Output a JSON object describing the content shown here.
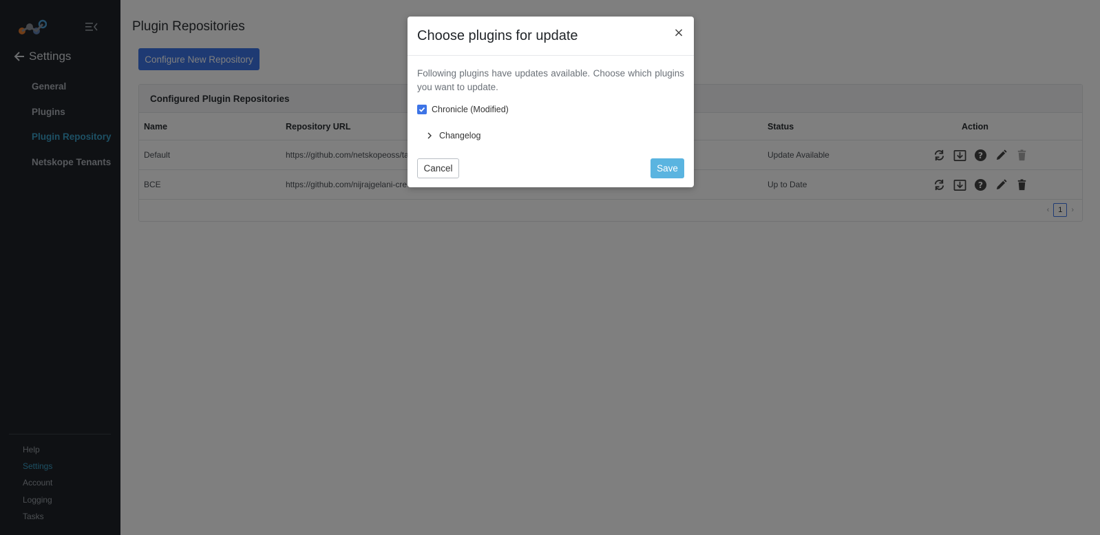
{
  "sidebar": {
    "logo_icon": "netskope-logo-icon",
    "collapse_icon": "menu-collapse-icon",
    "back_icon": "arrow-left-icon",
    "heading": "Settings",
    "items": [
      {
        "label": "General",
        "active": false
      },
      {
        "label": "Plugins",
        "active": false
      },
      {
        "label": "Plugin Repository",
        "active": true
      },
      {
        "label": "Netskope Tenants",
        "active": false
      }
    ],
    "footer": [
      {
        "label": "Help",
        "active": false
      },
      {
        "label": "Settings",
        "active": true
      },
      {
        "label": "Account",
        "active": false
      },
      {
        "label": "Logging",
        "active": false
      },
      {
        "label": "Tasks",
        "active": false
      }
    ]
  },
  "main": {
    "title": "Plugin Repositories",
    "configure_button": "Configure New Repository",
    "card_title": "Configured Plugin Repositories",
    "columns": {
      "name": "Name",
      "url": "Repository URL",
      "status": "Status",
      "action": "Action"
    },
    "rows": [
      {
        "name": "Default",
        "url": "https://github.com/netskopeoss/ta",
        "status": "Update Available"
      },
      {
        "name": "BCE",
        "url": "https://github.com/nijrajgelani-cre",
        "status": "Up to Date"
      }
    ],
    "action_icons": [
      "sync-icon",
      "download-icon",
      "help-icon",
      "edit-icon",
      "delete-icon"
    ],
    "pagination": {
      "current_page": "1"
    }
  },
  "modal": {
    "title": "Choose plugins for update",
    "close_label": "×",
    "description": "Following plugins have updates available. Choose which plugins you want to update.",
    "plugin": {
      "label": "Chronicle (Modified)",
      "checked": true
    },
    "changelog_label": "Changelog",
    "cancel_label": "Cancel",
    "save_label": "Save"
  },
  "colors": {
    "sidebar_bg": "#1e2329",
    "accent": "#3d74e6",
    "active_nav": "#3aa0c8",
    "save_button": "#5ab4e0"
  }
}
